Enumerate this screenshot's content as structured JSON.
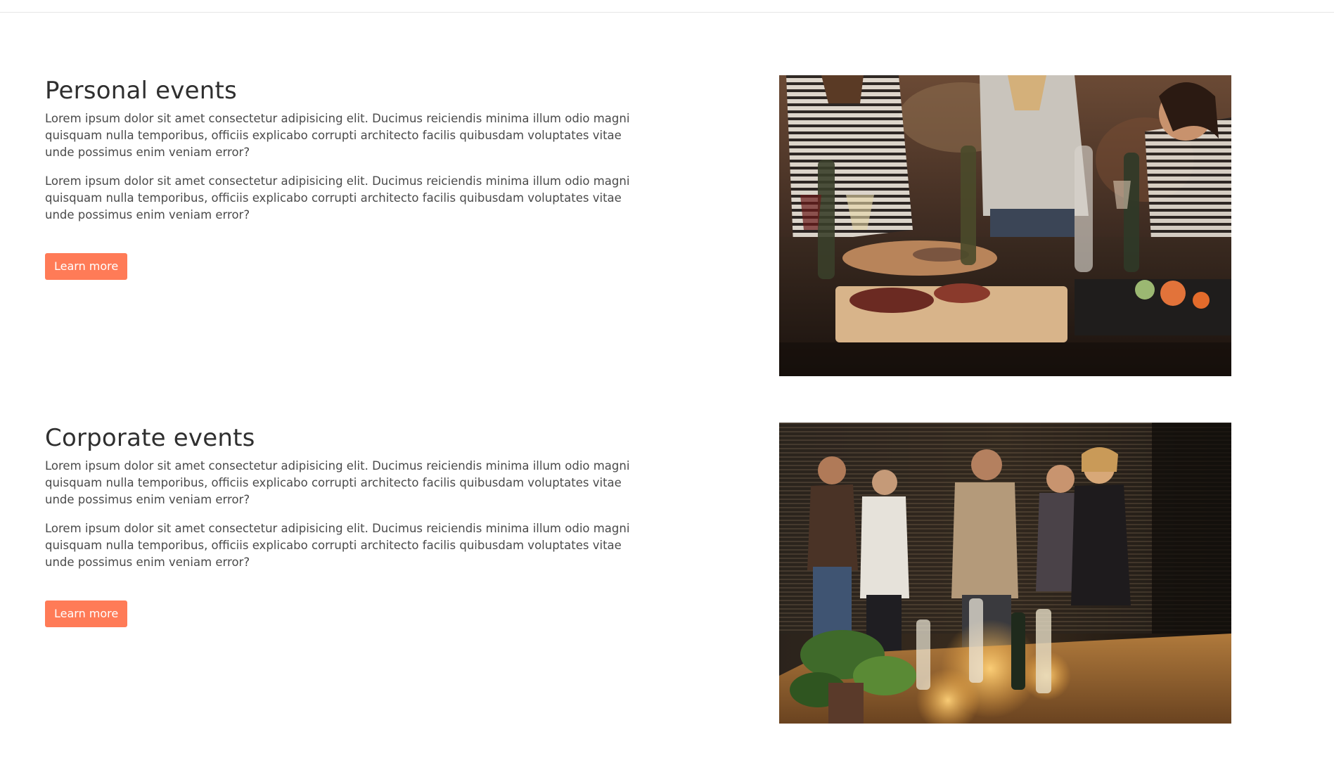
{
  "sections": [
    {
      "title": "Personal events",
      "paragraphs": [
        "Lorem ipsum dolor sit amet consectetur adipisicing elit. Ducimus reiciendis minima illum odio magni quisquam nulla temporibus, officiis explicabo corrupti architecto facilis quibusdam voluptates vitae unde possimus enim veniam error?",
        "Lorem ipsum dolor sit amet consectetur adipisicing elit. Ducimus reiciendis minima illum odio magni quisquam nulla temporibus, officiis explicabo corrupti architecto facilis quibusdam voluptates vitae unde possimus enim veniam error?"
      ],
      "button_label": "Learn more"
    },
    {
      "title": "Corporate events",
      "paragraphs": [
        "Lorem ipsum dolor sit amet consectetur adipisicing elit. Ducimus reiciendis minima illum odio magni quisquam nulla temporibus, officiis explicabo corrupti architecto facilis quibusdam voluptates vitae unde possimus enim veniam error?",
        "Lorem ipsum dolor sit amet consectetur adipisicing elit. Ducimus reiciendis minima illum odio magni quisquam nulla temporibus, officiis explicabo corrupti architecto facilis quibusdam voluptates vitae unde possimus enim veniam error?"
      ],
      "button_label": "Learn more"
    }
  ],
  "colors": {
    "accent": "#ff7b57",
    "heading": "#2f2f2f",
    "body_text": "#4a4a4a",
    "divider": "#e6e6e6"
  }
}
